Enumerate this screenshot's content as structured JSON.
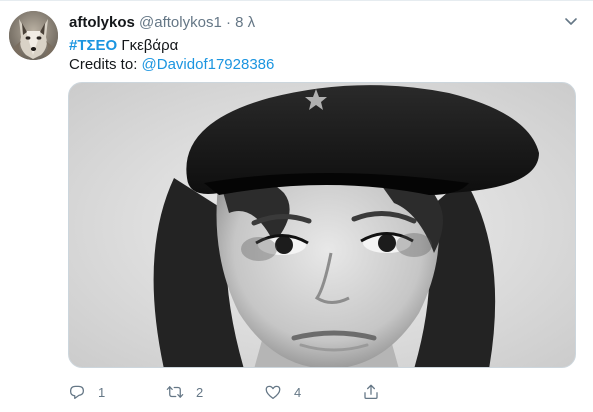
{
  "tweet": {
    "display_name": "aftolykos",
    "handle": "@aftolykos1",
    "separator": "·",
    "time": "8 λ",
    "hashtag": "#ΤΣΕΟ",
    "text_after_hashtag": " Γκεβάρα",
    "credits_label": "Credits to: ",
    "credits_mention": "@Davidof17928386"
  },
  "actions": {
    "reply_count": "1",
    "retweet_count": "2",
    "like_count": "4"
  },
  "colors": {
    "link": "#1b95e0",
    "muted": "#657786"
  },
  "icons": {
    "avatar": "wolf-avatar",
    "caret": "chevron-down-icon",
    "reply": "reply-icon",
    "retweet": "retweet-icon",
    "like": "heart-icon",
    "share": "share-icon"
  }
}
